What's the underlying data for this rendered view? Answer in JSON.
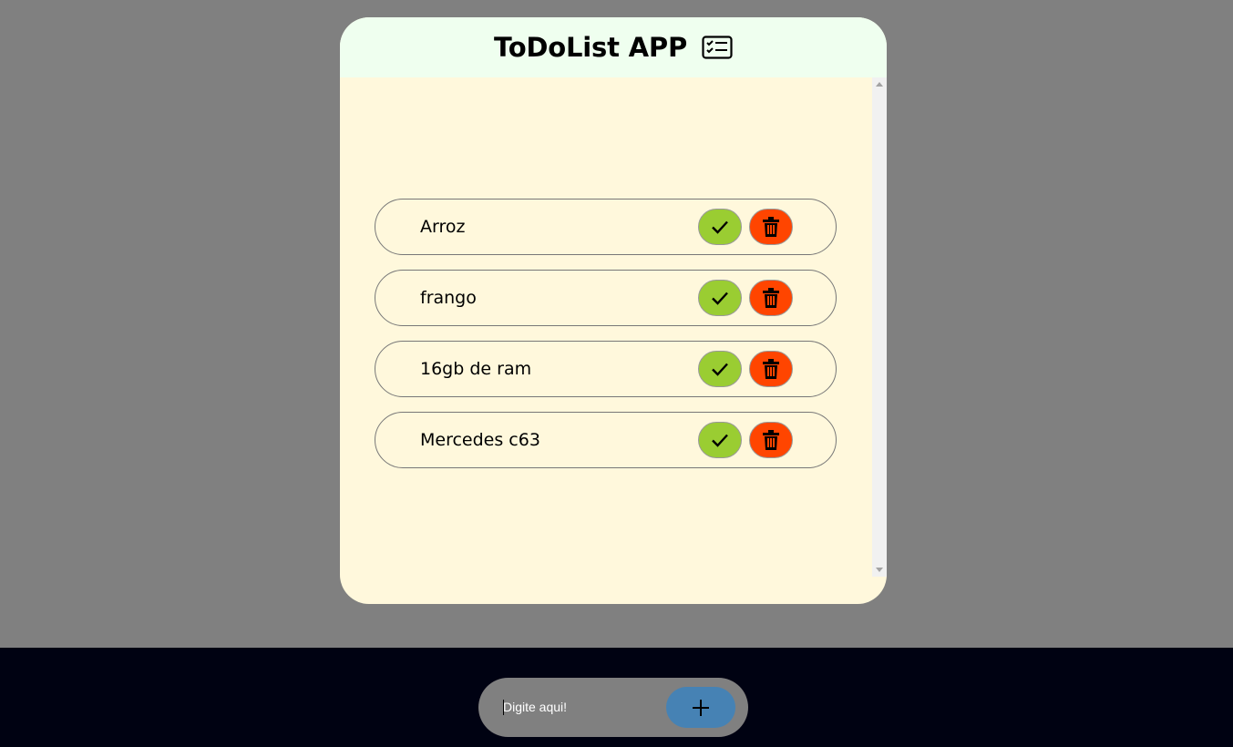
{
  "header": {
    "title": "ToDoList APP",
    "icon": "checklist-icon"
  },
  "tasks": [
    {
      "text": "Arroz",
      "done_icon": "check-icon",
      "delete_icon": "trash-icon"
    },
    {
      "text": "frango",
      "done_icon": "check-icon",
      "delete_icon": "trash-icon"
    },
    {
      "text": "16gb de ram",
      "done_icon": "check-icon",
      "delete_icon": "trash-icon"
    },
    {
      "text": "Mercedes c63",
      "done_icon": "check-icon",
      "delete_icon": "trash-icon"
    }
  ],
  "input": {
    "placeholder": "Digite aqui!",
    "value": ""
  },
  "add_button": {
    "icon": "plus-icon"
  },
  "colors": {
    "page_background": "#808080",
    "header_background": "#efffef",
    "card_background": "#fff8dc",
    "done_button": "#9acd32",
    "delete_button": "#ff4500",
    "add_button": "#4682b4",
    "bottom_bar": "#000212"
  }
}
